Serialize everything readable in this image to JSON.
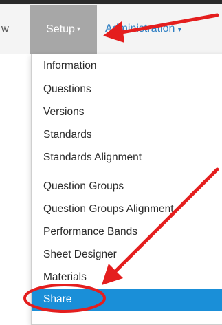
{
  "nav": {
    "prev_label": "w",
    "setup_label": "Setup",
    "admin_label": "Administration",
    "caret": "▾"
  },
  "menu": {
    "items": [
      {
        "label": "Information"
      },
      {
        "label": "Questions"
      },
      {
        "label": "Versions"
      },
      {
        "label": "Standards"
      },
      {
        "label": "Standards Alignment"
      },
      {
        "label": "Question Groups"
      },
      {
        "label": "Question Groups Alignment"
      },
      {
        "label": "Performance Bands"
      },
      {
        "label": "Sheet Designer"
      },
      {
        "label": "Materials"
      },
      {
        "label": "Share",
        "active": true
      }
    ]
  },
  "colors": {
    "annotation_red": "#e41e1e",
    "active_blue": "#1a8fd8",
    "setup_bg": "#a7a7a7",
    "admin_link": "#2f7fc3"
  }
}
